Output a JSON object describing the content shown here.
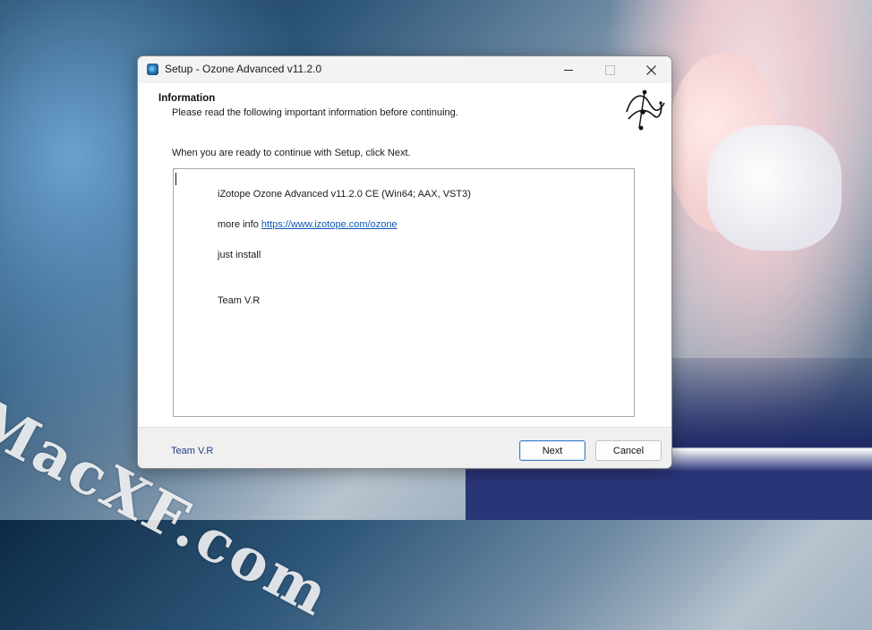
{
  "window": {
    "title": "Setup - Ozone Advanced v11.2.0"
  },
  "header": {
    "title": "Information",
    "subtitle": "Please read the following important information before continuing."
  },
  "intro": "When you are ready to continue with Setup, click Next.",
  "info": {
    "product_line": "iZotope Ozone Advanced v11.2.0 CE (Win64; AAX, VST3)",
    "more_info_label": "more info",
    "more_info_link": "https://www.izotope.com/ozone",
    "install_note": "just install",
    "team": "Team V.R"
  },
  "footer": {
    "brand": "Team V.R",
    "next_label": "Next",
    "cancel_label": "Cancel"
  },
  "background": {
    "watermark": "MacXF.com"
  },
  "colors": {
    "link": "#0b57b4",
    "arrow": "#e0242a",
    "brand": "#1f3c8a",
    "next_border": "#3c7fc8"
  }
}
